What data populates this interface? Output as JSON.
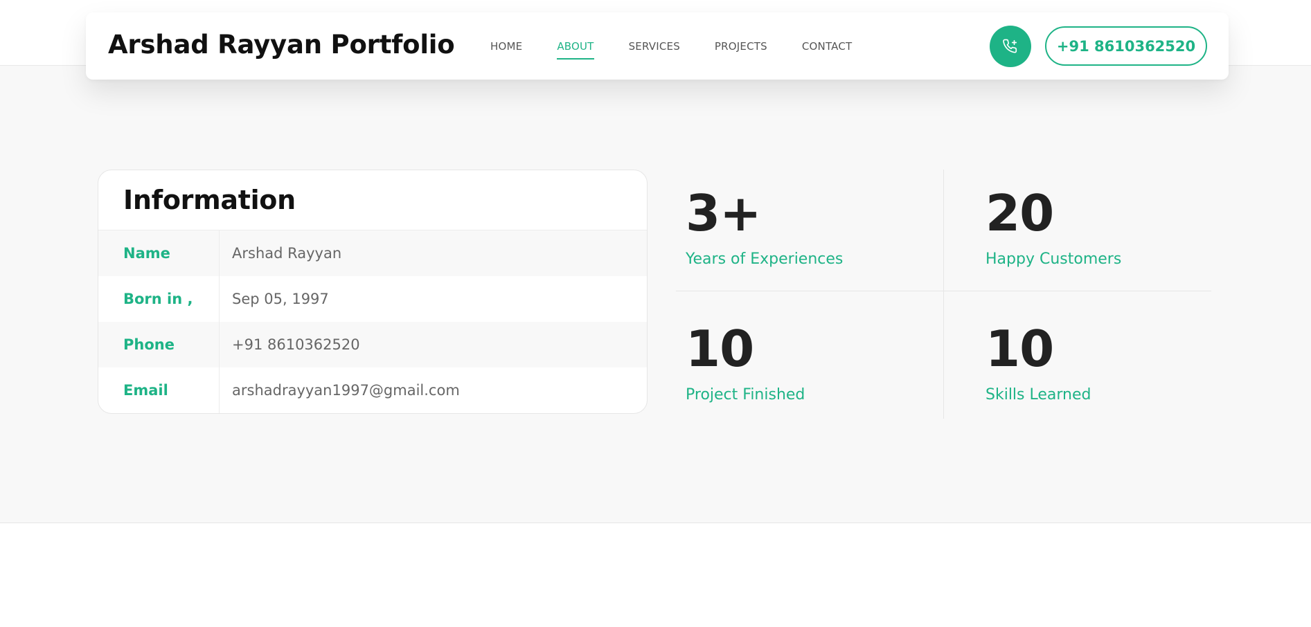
{
  "brand": "Arshad Rayyan Portfolio",
  "nav": {
    "items": [
      {
        "label": "HOME"
      },
      {
        "label": "ABOUT"
      },
      {
        "label": "SERVICES"
      },
      {
        "label": "PROJECTS"
      },
      {
        "label": "CONTACT"
      }
    ],
    "active": "ABOUT"
  },
  "header": {
    "phone_icon": "phone-plus-icon",
    "phone": "+91 8610362520"
  },
  "info": {
    "title": "Information",
    "rows": [
      {
        "label": "Name",
        "value": "Arshad Rayyan"
      },
      {
        "label": "Born in ,",
        "value": "Sep 05, 1997"
      },
      {
        "label": "Phone",
        "value": "+91 8610362520"
      },
      {
        "label": "Email",
        "value": "arshadrayyan1997@gmail.com"
      }
    ]
  },
  "stats": [
    {
      "value": "3+",
      "label": "Years of Experiences"
    },
    {
      "value": "20",
      "label": "Happy Customers"
    },
    {
      "value": "10",
      "label": "Project Finished"
    },
    {
      "value": "10",
      "label": "Skills Learned"
    }
  ],
  "colors": {
    "accent": "#1eb386",
    "heading": "#111111",
    "section_bg": "#f8f8f8"
  }
}
